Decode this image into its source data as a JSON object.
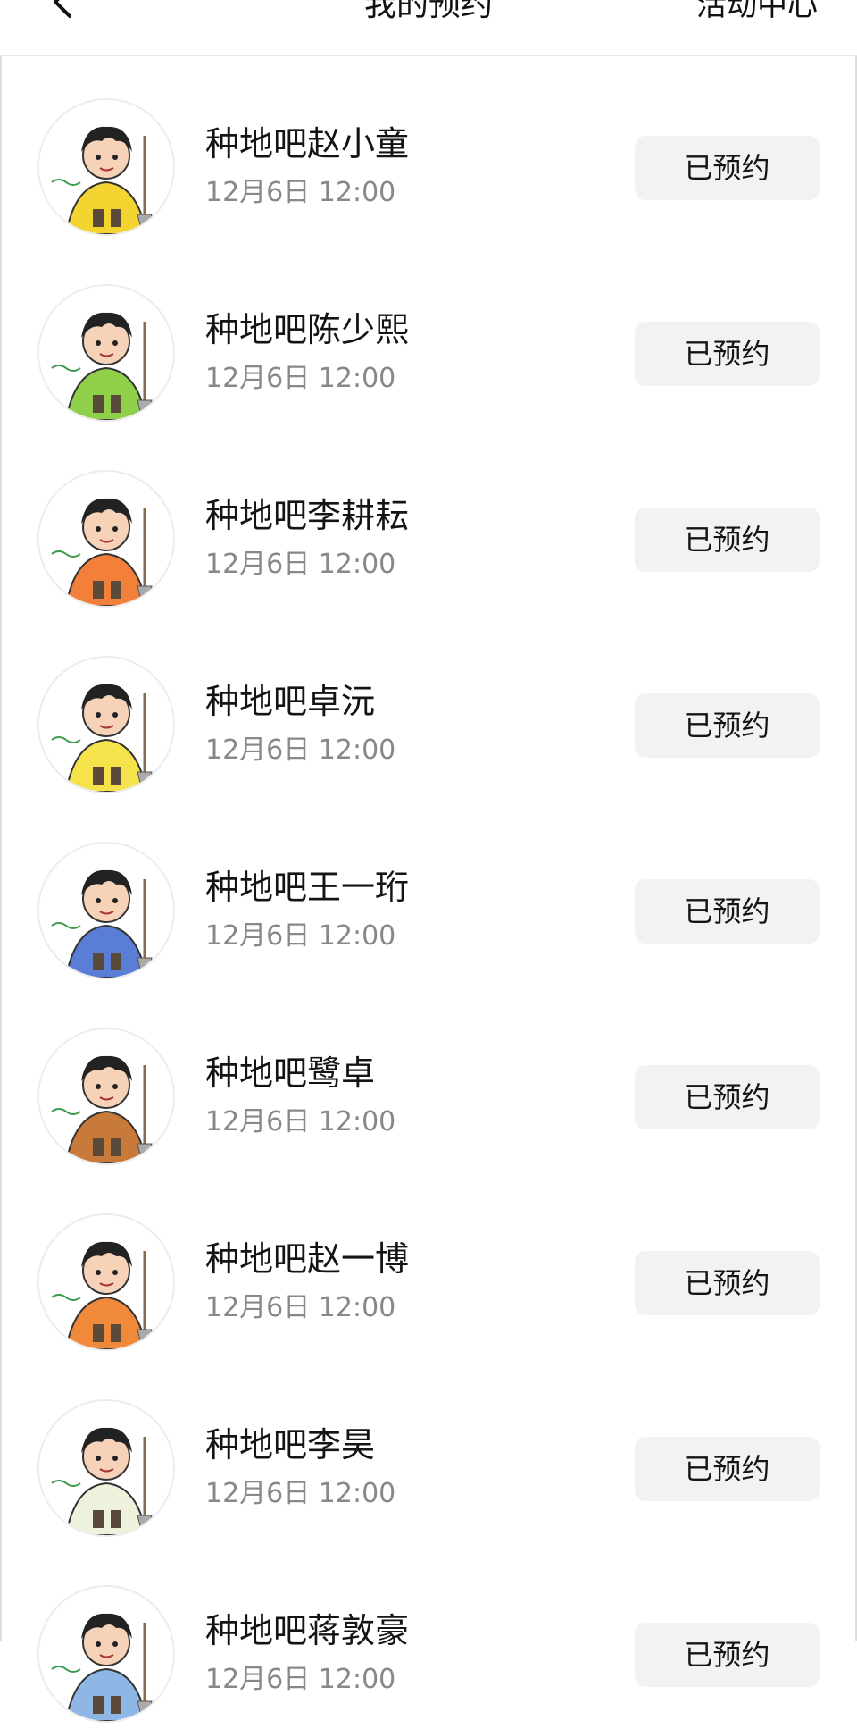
{
  "header": {
    "title": "我的预约",
    "right_link": "活动中心",
    "back_icon": "chevron-left-icon"
  },
  "reservations": [
    {
      "name": "种地吧赵小童",
      "time": "12月6日 12:00",
      "status": "已预约",
      "accent": "#f4d430"
    },
    {
      "name": "种地吧陈少熙",
      "time": "12月6日 12:00",
      "status": "已预约",
      "accent": "#8fcf4a"
    },
    {
      "name": "种地吧李耕耘",
      "time": "12月6日 12:00",
      "status": "已预约",
      "accent": "#f2803a"
    },
    {
      "name": "种地吧卓沅",
      "time": "12月6日 12:00",
      "status": "已预约",
      "accent": "#f6e24a"
    },
    {
      "name": "种地吧王一珩",
      "time": "12月6日 12:00",
      "status": "已预约",
      "accent": "#5a7ed6"
    },
    {
      "name": "种地吧鹭卓",
      "time": "12月6日 12:00",
      "status": "已预约",
      "accent": "#c87a3a"
    },
    {
      "name": "种地吧赵一博",
      "time": "12月6日 12:00",
      "status": "已预约",
      "accent": "#f08a3a"
    },
    {
      "name": "种地吧李昊",
      "time": "12月6日 12:00",
      "status": "已预约",
      "accent": "#eef2dd"
    },
    {
      "name": "种地吧蒋敦豪",
      "time": "12月6日 12:00",
      "status": "已预约",
      "accent": "#8fb7e6"
    }
  ]
}
